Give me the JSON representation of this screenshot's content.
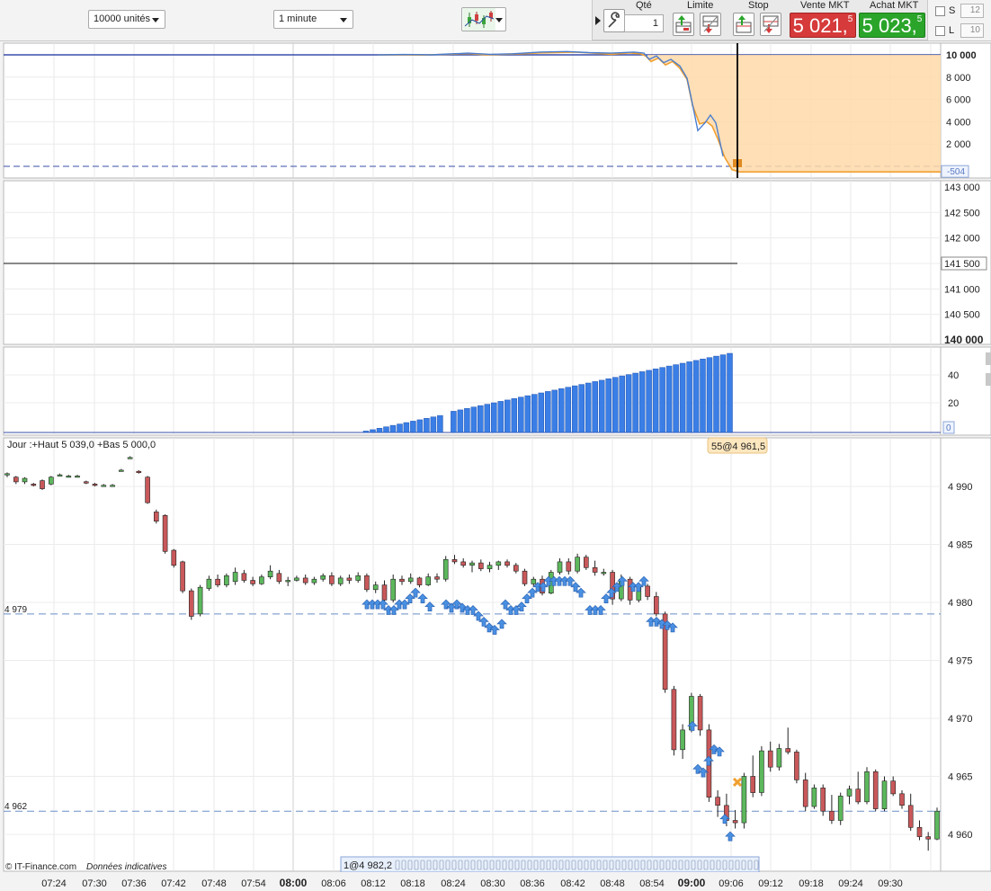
{
  "toolbar": {
    "quantity_select": "10000 unités",
    "interval_select": "1 minute",
    "chart_type_icon": "candlestick-chart-icon",
    "play_icon": "play-triangle-icon",
    "settings_icon": "wrench-icon",
    "qty_label": "Qté",
    "qty_value": "1",
    "limit_label": "Limite",
    "stop_label": "Stop",
    "sell_label": "Vente MKT",
    "sell_main": "5 021,",
    "sell_sup": "5",
    "buy_label": "Achat MKT",
    "buy_main": "5 023,",
    "buy_sup": "5",
    "s_label": "S",
    "s_value": "12",
    "l_label": "L",
    "l_value": "10"
  },
  "colors": {
    "sell": "#d63a3a",
    "buy": "#2aa52a",
    "up_candle": "#5cb85c",
    "down_candle": "#c9585a",
    "arrow": "#4a90e2",
    "volume_bar": "#3a7ee6",
    "area_fill": "#ffd9a8",
    "line_orange": "#f0a030",
    "line_blue": "#4a7ed0"
  },
  "panels": {
    "pnl": {
      "ticks": [
        "10 000",
        "8 000",
        "6 000",
        "4 000",
        "2 000"
      ],
      "current_badge": "-504"
    },
    "account": {
      "ticks": [
        "143 000",
        "142 500",
        "142 000",
        "141 500",
        "141 000",
        "140 500",
        "140 000"
      ],
      "current_badge": "141 500"
    },
    "count": {
      "ticks": [
        "40",
        "20"
      ],
      "current_badge": "0"
    },
    "price": {
      "day_info": "Jour :+Haut 5 039,0 +Bas 5 000,0",
      "position_badge": "55@4 961,5",
      "ticks": [
        "4 990",
        "4 985",
        "4 980",
        "4 975",
        "4 970",
        "4 965",
        "4 960"
      ],
      "level_a": "4 979",
      "level_b": "4 962",
      "trade_strip_label": "1@4 982,2",
      "copyright": "© IT-Finance.com",
      "disclaimer": "Données indicatives"
    }
  },
  "chart_data": [
    {
      "type": "area",
      "series": [],
      "ylim": [
        0,
        10000
      ]
    },
    {
      "type": "line",
      "series": [],
      "ylim": [
        140000,
        143000
      ]
    },
    {
      "type": "bar",
      "values": [
        1,
        2,
        3,
        4,
        5,
        6,
        7,
        8,
        9,
        10,
        11,
        12,
        14,
        15,
        16,
        17,
        18,
        19,
        20,
        21,
        22,
        23,
        24,
        25,
        26,
        27,
        28,
        29,
        30,
        31,
        32,
        33,
        34,
        35,
        36,
        37,
        38,
        39,
        40,
        41,
        42,
        43,
        44,
        45,
        46,
        47,
        48,
        49,
        50,
        51,
        52,
        53,
        54,
        55,
        56
      ],
      "ylim": [
        0,
        56
      ]
    },
    {
      "type": "candlestick",
      "x": [
        "07:24",
        "07:30",
        "07:36",
        "07:42",
        "07:48",
        "07:54",
        "08:00",
        "08:06",
        "08:12",
        "08:18",
        "08:24",
        "08:30",
        "08:36",
        "08:42",
        "08:48",
        "08:54",
        "09:00",
        "09:06",
        "09:12",
        "09:18",
        "09:24",
        "09:30"
      ],
      "ylim": [
        4958,
        4992
      ],
      "candles": [
        [
          4991,
          4991.2,
          4990.8,
          4991.1
        ],
        [
          4990.8,
          4990.9,
          4990.2,
          4990.4
        ],
        [
          4990.4,
          4990.8,
          4990.2,
          4990.7
        ],
        [
          4990.2,
          4990.3,
          4990,
          4990.1
        ],
        [
          4990.5,
          4990.6,
          4989.7,
          4989.8
        ],
        [
          4990.2,
          4990.9,
          4990.1,
          4990.8
        ],
        [
          4991,
          4991.1,
          4990.9,
          4991
        ],
        [
          4990.9,
          4991,
          4990.8,
          4990.9
        ],
        [
          4990.9,
          4991,
          4990.8,
          4990.9
        ],
        [
          4990.4,
          4990.5,
          4990.2,
          4990.3
        ],
        [
          4990.2,
          4990.3,
          4990,
          4990.1
        ],
        [
          4990.1,
          4990.2,
          4990,
          4990.1
        ],
        [
          4990.1,
          4990.2,
          4990,
          4990.1
        ],
        [
          4991.4,
          4991.5,
          4991.3,
          4991.4
        ],
        [
          4992.5,
          4992.6,
          4992.4,
          4992.5
        ],
        [
          4991.3,
          4991.4,
          4991.1,
          4991.2
        ],
        [
          4990.8,
          4990.9,
          4988.5,
          4988.6
        ],
        [
          4987.8,
          4988,
          4986.8,
          4987
        ],
        [
          4987.5,
          4987.6,
          4984.2,
          4984.4
        ],
        [
          4984.5,
          4984.6,
          4983,
          4983.2
        ],
        [
          4983.5,
          4983.6,
          4980.8,
          4981
        ],
        [
          4981,
          4981.2,
          4978.5,
          4978.8
        ],
        [
          4979,
          4981.5,
          4978.8,
          4981.3
        ],
        [
          4981.2,
          4982.3,
          4981,
          4982
        ],
        [
          4982,
          4982.4,
          4981.3,
          4981.5
        ],
        [
          4981.5,
          4982.5,
          4981.3,
          4982.3
        ],
        [
          4981.8,
          4983,
          4981.5,
          4982.6
        ],
        [
          4982.5,
          4982.8,
          4981.7,
          4981.9
        ],
        [
          4981.9,
          4982.2,
          4981.4,
          4981.6
        ],
        [
          4981.6,
          4982.4,
          4981.5,
          4982.2
        ],
        [
          4982.2,
          4983.2,
          4982,
          4982.7
        ],
        [
          4982.5,
          4982.8,
          4981.6,
          4981.8
        ],
        [
          4981.8,
          4982.2,
          4981.4,
          4981.9
        ],
        [
          4981.9,
          4982.3,
          4981.8,
          4982.1
        ],
        [
          4982.1,
          4982.4,
          4981.5,
          4981.7
        ],
        [
          4981.7,
          4982.2,
          4981.5,
          4982
        ],
        [
          4982,
          4982.5,
          4981.8,
          4982.3
        ],
        [
          4982.3,
          4982.6,
          4981.4,
          4981.6
        ],
        [
          4981.6,
          4982.3,
          4981.4,
          4982.1
        ],
        [
          4982.1,
          4982.4,
          4981.6,
          4981.9
        ],
        [
          4981.9,
          4982.6,
          4981.7,
          4982.3
        ],
        [
          4982.3,
          4982.5,
          4980.9,
          4981.1
        ],
        [
          4981.1,
          4981.8,
          4980.8,
          4981.5
        ],
        [
          4981.5,
          4981.9,
          4979.8,
          4980.2
        ],
        [
          4980.2,
          4982.4,
          4980,
          4982
        ],
        [
          4982,
          4982.3,
          4981.5,
          4981.8
        ],
        [
          4981.8,
          4982.5,
          4981.6,
          4982.1
        ],
        [
          4982.1,
          4982.2,
          4981.3,
          4981.5
        ],
        [
          4981.5,
          4982.5,
          4981.4,
          4982.2
        ],
        [
          4982.2,
          4982.5,
          4981.7,
          4982
        ],
        [
          4982,
          4984,
          4981.8,
          4983.7
        ],
        [
          4983.7,
          4984.1,
          4983.3,
          4983.5
        ],
        [
          4983.5,
          4983.8,
          4983,
          4983.2
        ],
        [
          4983.2,
          4983.6,
          4982.6,
          4983.4
        ],
        [
          4983.4,
          4983.7,
          4982.7,
          4982.9
        ],
        [
          4982.9,
          4983.5,
          4982.6,
          4983.2
        ],
        [
          4983.2,
          4983.6,
          4982.8,
          4983.5
        ],
        [
          4983.5,
          4983.7,
          4983,
          4983.2
        ],
        [
          4983.2,
          4983.4,
          4982.5,
          4982.7
        ],
        [
          4982.7,
          4982.9,
          4981.4,
          4981.6
        ],
        [
          4981.6,
          4982.2,
          4981.4,
          4982
        ],
        [
          4982,
          4982.3,
          4980.6,
          4980.8
        ],
        [
          4980.8,
          4982.8,
          4980.7,
          4982.6
        ],
        [
          4982.6,
          4983.8,
          4982.4,
          4983.5
        ],
        [
          4983.5,
          4983.8,
          4982.4,
          4982.7
        ],
        [
          4982.7,
          4984.2,
          4982.5,
          4983.9
        ],
        [
          4983.9,
          4984.1,
          4982.8,
          4983
        ],
        [
          4983,
          4983.6,
          4982.3,
          4982.6
        ],
        [
          4982.6,
          4982.9,
          4982.3,
          4982.6
        ],
        [
          4982.6,
          4982.8,
          4979.8,
          4980.3
        ],
        [
          4980.3,
          4982.4,
          4980.1,
          4982
        ],
        [
          4982,
          4982.2,
          4979.8,
          4980.2
        ],
        [
          4980.2,
          4981.6,
          4980,
          4981.4
        ],
        [
          4981.4,
          4981.6,
          4980.2,
          4980.5
        ],
        [
          4980.5,
          4980.9,
          4978.8,
          4979
        ],
        [
          4979,
          4979.2,
          4972.2,
          4972.5
        ],
        [
          4972.5,
          4972.8,
          4966.8,
          4967.3
        ],
        [
          4967.3,
          4969.5,
          4966.5,
          4969
        ],
        [
          4969,
          4972.2,
          4968.8,
          4971.9
        ],
        [
          4971.9,
          4972.1,
          4968.5,
          4969
        ],
        [
          4969,
          4969.5,
          4962.8,
          4963.2
        ],
        [
          4963.2,
          4963.8,
          4961.5,
          4962.5
        ],
        [
          4962.5,
          4963.5,
          4960.7,
          4961.2
        ],
        [
          4961.2,
          4962.1,
          4960.5,
          4961
        ],
        [
          4961,
          4965.3,
          4960.5,
          4965
        ],
        [
          4965,
          4966.8,
          4963.2,
          4963.6
        ],
        [
          4963.6,
          4967.6,
          4963.3,
          4967.2
        ],
        [
          4967.2,
          4968,
          4965.4,
          4965.8
        ],
        [
          4965.8,
          4967.8,
          4965.5,
          4967.4
        ],
        [
          4967.4,
          4969.2,
          4966.9,
          4967.1
        ],
        [
          4967.1,
          4967.3,
          4964.4,
          4964.7
        ],
        [
          4964.7,
          4965.3,
          4962,
          4962.4
        ],
        [
          4962.4,
          4964.3,
          4962.2,
          4964
        ],
        [
          4964,
          4964.3,
          4961.6,
          4962
        ],
        [
          4962,
          4963.4,
          4960.9,
          4961.2
        ],
        [
          4961.2,
          4963.6,
          4960.8,
          4963.3
        ],
        [
          4963.3,
          4964.2,
          4962.6,
          4963.9
        ],
        [
          4963.9,
          4965.4,
          4962.6,
          4962.8
        ],
        [
          4962.8,
          4965.8,
          4962.6,
          4965.4
        ],
        [
          4965.4,
          4965.6,
          4962,
          4962.2
        ],
        [
          4962.2,
          4965,
          4962,
          4964.6
        ],
        [
          4964.6,
          4965,
          4963.3,
          4963.5
        ],
        [
          4963.5,
          4963.8,
          4962.2,
          4962.5
        ],
        [
          4962.5,
          4963.5,
          4960.3,
          4960.6
        ],
        [
          4960.6,
          4961.2,
          4959.5,
          4959.8
        ],
        [
          4959.8,
          4960.2,
          4958.6,
          4959.6
        ],
        [
          4959.6,
          4962.3,
          4959.5,
          4962
        ]
      ]
    }
  ]
}
